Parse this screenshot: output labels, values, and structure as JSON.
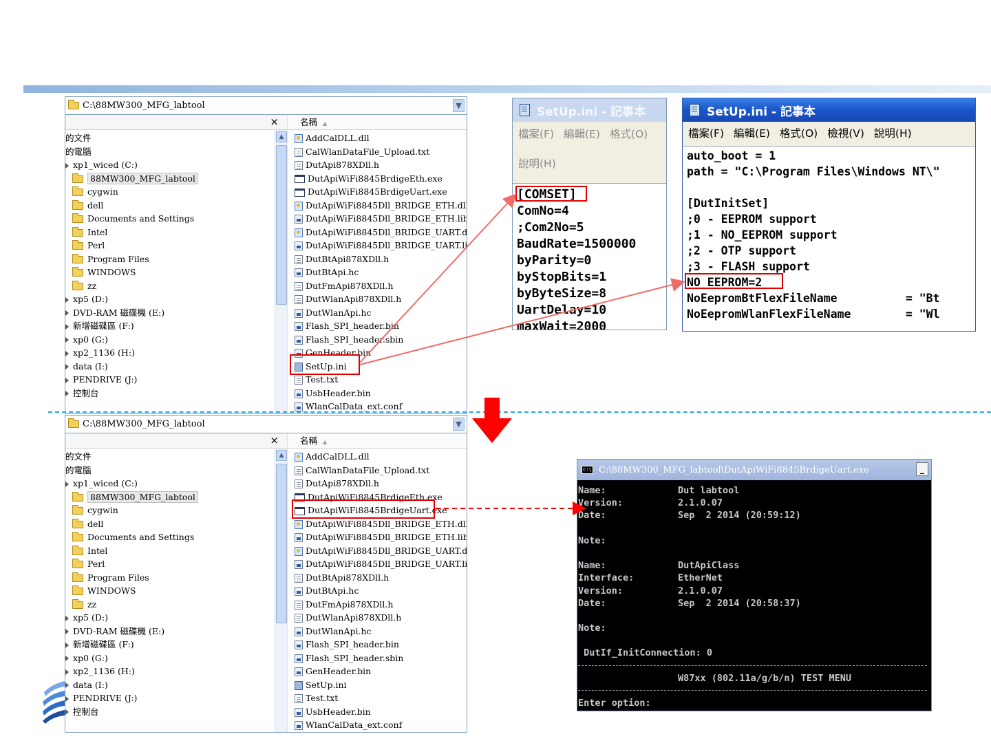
{
  "explorer": {
    "address": "C:\\88MW300_MFG_labtool",
    "column_name": "名稱",
    "tree_close": "×",
    "tree_items": [
      {
        "label": "的文件",
        "kind": "plain"
      },
      {
        "label": "的電腦",
        "kind": "plain"
      },
      {
        "label": "xp1_wiced (C:)",
        "kind": "drive"
      },
      {
        "label": "88MW300_MFG_labtool",
        "kind": "folder-sel"
      },
      {
        "label": "cygwin",
        "kind": "folder"
      },
      {
        "label": "dell",
        "kind": "folder"
      },
      {
        "label": "Documents and Settings",
        "kind": "folder"
      },
      {
        "label": "Intel",
        "kind": "folder"
      },
      {
        "label": "Perl",
        "kind": "folder"
      },
      {
        "label": "Program Files",
        "kind": "folder"
      },
      {
        "label": "WINDOWS",
        "kind": "folder"
      },
      {
        "label": "zz",
        "kind": "folder"
      },
      {
        "label": "xp5 (D:)",
        "kind": "drive"
      },
      {
        "label": "DVD-RAM 磁碟機 (E:)",
        "kind": "drive"
      },
      {
        "label": "新增磁碟區 (F:)",
        "kind": "drive"
      },
      {
        "label": "xp0 (G:)",
        "kind": "drive"
      },
      {
        "label": "xp2_1136 (H:)",
        "kind": "drive"
      },
      {
        "label": "data (I:)",
        "kind": "drive"
      },
      {
        "label": "PENDRIVE (J:)",
        "kind": "drive"
      },
      {
        "label": "控制台",
        "kind": "drive"
      }
    ],
    "files": [
      {
        "name": "AddCalDLL.dll",
        "type": "dll"
      },
      {
        "name": "CalWlanDataFile_Upload.txt",
        "type": "txt"
      },
      {
        "name": "DutApi878XDll.h",
        "type": "txt"
      },
      {
        "name": "DutApiWiFi8845BrdigeEth.exe",
        "type": "exe"
      },
      {
        "name": "DutApiWiFi8845BrdigeUart.exe",
        "type": "exe"
      },
      {
        "name": "DutApiWiFi8845Dll_BRIDGE_ETH.dll",
        "type": "dll"
      },
      {
        "name": "DutApiWiFi8845Dll_BRIDGE_ETH.lib",
        "type": "bin"
      },
      {
        "name": "DutApiWiFi8845Dll_BRIDGE_UART.dll",
        "type": "dll"
      },
      {
        "name": "DutApiWiFi8845Dll_BRIDGE_UART.lib",
        "type": "bin"
      },
      {
        "name": "DutBtApi878XDll.h",
        "type": "txt"
      },
      {
        "name": "DutBtApi.hc",
        "type": "bin"
      },
      {
        "name": "DutFmApi878XDll.h",
        "type": "txt"
      },
      {
        "name": "DutWlanApi878XDll.h",
        "type": "txt"
      },
      {
        "name": "DutWlanApi.hc",
        "type": "bin"
      },
      {
        "name": "Flash_SPI_header.bin",
        "type": "bin"
      },
      {
        "name": "Flash_SPI_header.sbin",
        "type": "bin"
      },
      {
        "name": "GenHeader.bin",
        "type": "bin"
      },
      {
        "name": "SetUp.ini",
        "type": "ini"
      },
      {
        "name": "Test.txt",
        "type": "txt"
      },
      {
        "name": "UsbHeader.bin",
        "type": "bin"
      },
      {
        "name": "WlanCalData_ext.conf",
        "type": "bin"
      }
    ]
  },
  "notepad_small": {
    "title": "SetUp.ini - 記事本",
    "menu": [
      "檔案(F)",
      "編輯(E)",
      "格式(O)",
      "說明(H)"
    ],
    "lines": [
      "[COMSET]",
      "ComNo=4",
      ";Com2No=5",
      "BaudRate=1500000",
      "byParity=0",
      "byStopBits=1",
      "byByteSize=8",
      "UartDelay=10",
      "maxWait=2000"
    ]
  },
  "notepad_large": {
    "title": "SetUp.ini - 記事本",
    "menu": [
      "檔案(F)",
      "編輯(E)",
      "格式(O)",
      "檢視(V)",
      "說明(H)"
    ],
    "lines": [
      "auto_boot = 1",
      "path = \"C:\\Program Files\\Windows NT\\\"",
      "",
      "[DutInitSet]",
      ";0 - EEPROM support",
      ";1 - NO_EEPROM support",
      ";2 - OTP support",
      ";3 - FLASH support",
      "NO_EEPROM=2",
      "NoEepromBtFlexFileName          = \"Bt",
      "NoEepromWlanFlexFileName        = \"Wl"
    ]
  },
  "console": {
    "title": "C:\\88MW300_MFG_labtool\\DutApiWiFi8845BrdigeUart.exe",
    "minimize": "_",
    "rows": [
      {
        "k": "Name:",
        "v": "Dut labtool"
      },
      {
        "k": "Version:",
        "v": "2.1.0.07"
      },
      {
        "k": "Date:",
        "v": "Sep  2 2014 (20:59:12)"
      },
      {
        "k": "",
        "v": ""
      },
      {
        "k": "Note:",
        "v": ""
      },
      {
        "k": "",
        "v": ""
      },
      {
        "k": "Name:",
        "v": "DutApiClass"
      },
      {
        "k": "Interface:",
        "v": "EtherNet"
      },
      {
        "k": "Version:",
        "v": "2.1.0.07"
      },
      {
        "k": "Date:",
        "v": "Sep  2 2014 (20:58:37)"
      },
      {
        "k": "",
        "v": ""
      },
      {
        "k": "Note:",
        "v": ""
      },
      {
        "k": "",
        "v": ""
      },
      {
        "k": " DutIf_InitConnection: 0",
        "v": ""
      },
      {
        "k": "---",
        "v": ""
      },
      {
        "k": "",
        "v": "W87xx (802.11a/g/b/n) TEST MENU"
      },
      {
        "k": "---",
        "v": ""
      },
      {
        "k": "Enter option:",
        "v": ""
      }
    ]
  },
  "colors": {
    "highlight": "#e00000",
    "arrow": "#f06a6a",
    "divider": "#27a7df"
  }
}
